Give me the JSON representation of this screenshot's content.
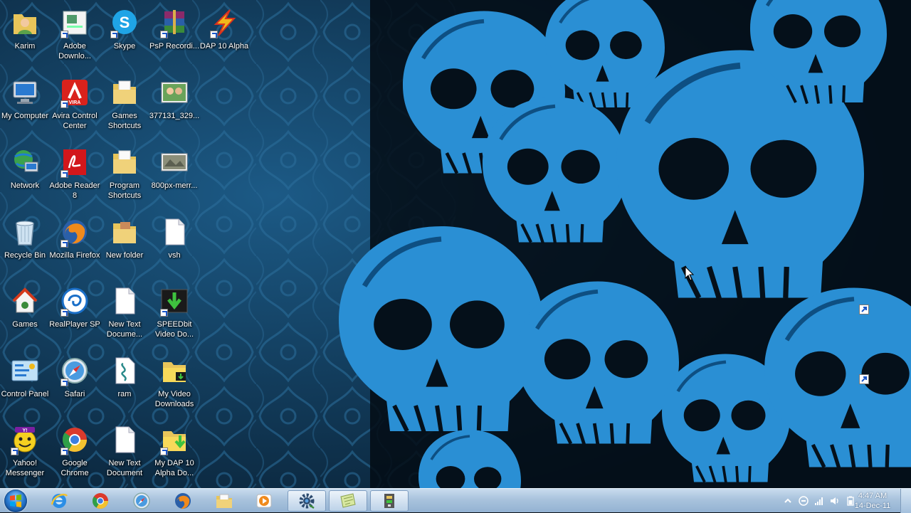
{
  "desktop": {
    "icons": [
      {
        "label": "Karim",
        "icon": "user-folder-icon"
      },
      {
        "label": "Adobe Downlo...",
        "icon": "adobe-download-icon"
      },
      {
        "label": "Skype",
        "icon": "skype-icon"
      },
      {
        "label": "PsP Recordi...",
        "icon": "winrar-archive-icon"
      },
      {
        "label": "DAP 10 Alpha",
        "icon": "dap-icon"
      },
      {
        "label": "My Computer",
        "icon": "computer-icon"
      },
      {
        "label": "Avira Control Center",
        "icon": "avira-icon"
      },
      {
        "label": "Games Shortcuts",
        "icon": "folder-icon"
      },
      {
        "label": "377131_329...",
        "icon": "photo-icon"
      },
      {
        "label": "Network",
        "icon": "network-icon"
      },
      {
        "label": "Adobe Reader 8",
        "icon": "pdf-reader-icon"
      },
      {
        "label": "Program Shortcuts",
        "icon": "folder-icon"
      },
      {
        "label": "800px-merr...",
        "icon": "image-file-icon"
      },
      {
        "label": "Recycle Bin",
        "icon": "recycle-bin-icon"
      },
      {
        "label": "Mozilla Firefox",
        "icon": "firefox-icon"
      },
      {
        "label": "New folder",
        "icon": "folder-icon"
      },
      {
        "label": "vsh",
        "icon": "blank-file-icon"
      },
      {
        "label": "Games",
        "icon": "games-icon"
      },
      {
        "label": "RealPlayer SP",
        "icon": "realplayer-icon"
      },
      {
        "label": "New Text Docume...",
        "icon": "text-file-icon"
      },
      {
        "label": "SPEEDbit Video Do...",
        "icon": "speedbit-icon"
      },
      {
        "label": "Control Panel",
        "icon": "control-panel-icon"
      },
      {
        "label": "Safari",
        "icon": "safari-icon"
      },
      {
        "label": "ram",
        "icon": "script-file-icon"
      },
      {
        "label": "My Video Downloads",
        "icon": "video-folder-icon"
      },
      {
        "label": "Yahoo! Messenger",
        "icon": "yahoo-messenger-icon"
      },
      {
        "label": "Google Chrome",
        "icon": "chrome-icon"
      },
      {
        "label": "New Text Document",
        "icon": "text-file-icon"
      },
      {
        "label": "My DAP 10 Alpha Do...",
        "icon": "download-folder-icon"
      }
    ]
  },
  "taskbar": {
    "pinned": [
      {
        "name": "internet-explorer",
        "icon": "internet-explorer-icon"
      },
      {
        "name": "chrome",
        "icon": "chrome-icon"
      },
      {
        "name": "safari",
        "icon": "safari-icon"
      },
      {
        "name": "firefox",
        "icon": "firefox-icon"
      },
      {
        "name": "explorer",
        "icon": "folder-icon"
      },
      {
        "name": "media-player",
        "icon": "media-player-icon"
      },
      {
        "name": "settings-tool",
        "icon": "gear-icon"
      },
      {
        "name": "notes",
        "icon": "notes-icon"
      },
      {
        "name": "archive-tool",
        "icon": "archive-icon"
      }
    ],
    "clock": {
      "time": "4:47 AM",
      "date": "14-Dec-11"
    }
  },
  "colors": {
    "wallpaper_base": "#0c2e48",
    "skull": "#2a8fd4",
    "taskbar": "#a9c3dd"
  }
}
